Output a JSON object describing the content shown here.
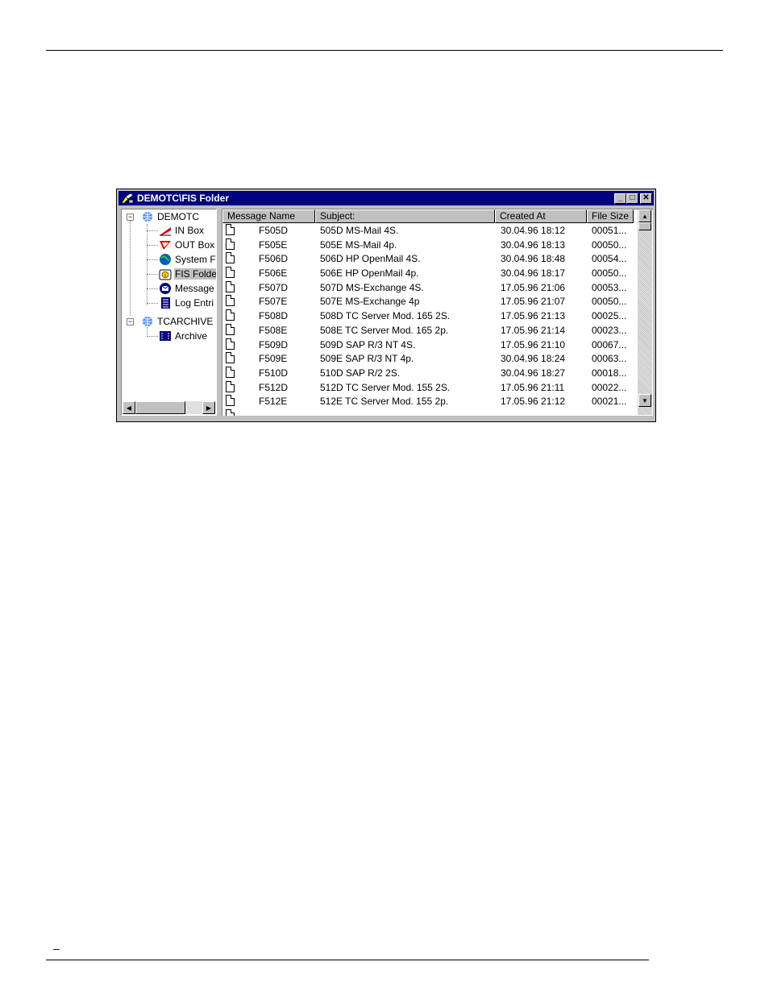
{
  "window": {
    "title": "DEMOTC\\FIS Folder",
    "buttons": {
      "minimize": "_",
      "maximize": "□",
      "close": "✕"
    }
  },
  "tree": {
    "nodes": [
      {
        "label": "DEMOTC",
        "icon": "globe-network-icon",
        "expander": "−"
      },
      {
        "label": "IN Box",
        "icon": "inbox-icon"
      },
      {
        "label": "OUT Box",
        "icon": "outbox-icon"
      },
      {
        "label": "System F",
        "icon": "system-folder-icon"
      },
      {
        "label": "FIS Folde",
        "icon": "fis-folder-icon",
        "selected": true
      },
      {
        "label": "Message",
        "icon": "message-icon"
      },
      {
        "label": "Log Entri",
        "icon": "log-entries-icon"
      },
      {
        "label": "TCARCHIVE",
        "icon": "globe-network-icon",
        "expander": "−"
      },
      {
        "label": "Archive",
        "icon": "archive-icon"
      }
    ]
  },
  "list": {
    "columns": [
      "Message Name",
      "Subject:",
      "Created At",
      "File Size"
    ],
    "rows": [
      {
        "name": "F505D",
        "subject": "505D MS-Mail 4S.",
        "created": "30.04.96 18:12",
        "size": "00051..."
      },
      {
        "name": "F505E",
        "subject": "505E MS-Mail 4p.",
        "created": "30.04.96 18:13",
        "size": "00050..."
      },
      {
        "name": "F506D",
        "subject": "506D HP OpenMail 4S.",
        "created": "30.04.96 18:48",
        "size": "00054..."
      },
      {
        "name": "F506E",
        "subject": "506E HP OpenMail 4p.",
        "created": "30.04.96 18:17",
        "size": "00050..."
      },
      {
        "name": "F507D",
        "subject": "507D MS-Exchange 4S.",
        "created": "17.05.96 21:06",
        "size": "00053..."
      },
      {
        "name": "F507E",
        "subject": "507E MS-Exchange 4p",
        "created": "17.05.96 21:07",
        "size": "00050..."
      },
      {
        "name": "F508D",
        "subject": "508D TC Server Mod. 165 2S.",
        "created": "17.05.96 21:13",
        "size": "00025..."
      },
      {
        "name": "F508E",
        "subject": "508E TC Server Mod. 165 2p.",
        "created": "17.05.96 21:14",
        "size": "00023..."
      },
      {
        "name": "F509D",
        "subject": "509D SAP R/3 NT 4S.",
        "created": "17.05.96 21:10",
        "size": "00067..."
      },
      {
        "name": "F509E",
        "subject": "509E SAP R/3 NT 4p.",
        "created": "30.04.96 18:24",
        "size": "00063..."
      },
      {
        "name": "F510D",
        "subject": "510D SAP R/2 2S.",
        "created": "30.04.96 18:27",
        "size": "00018..."
      },
      {
        "name": "F512D",
        "subject": "512D TC Server Mod. 155 2S.",
        "created": "17.05.96 21:11",
        "size": "00022..."
      },
      {
        "name": "F512E",
        "subject": "512E TC Server Mod. 155 2p.",
        "created": "17.05.96 21:12",
        "size": "00021..."
      }
    ]
  },
  "footer": {
    "mark": "–"
  },
  "colors": {
    "titlebar": "#000080",
    "chrome": "#c0c0c0"
  }
}
